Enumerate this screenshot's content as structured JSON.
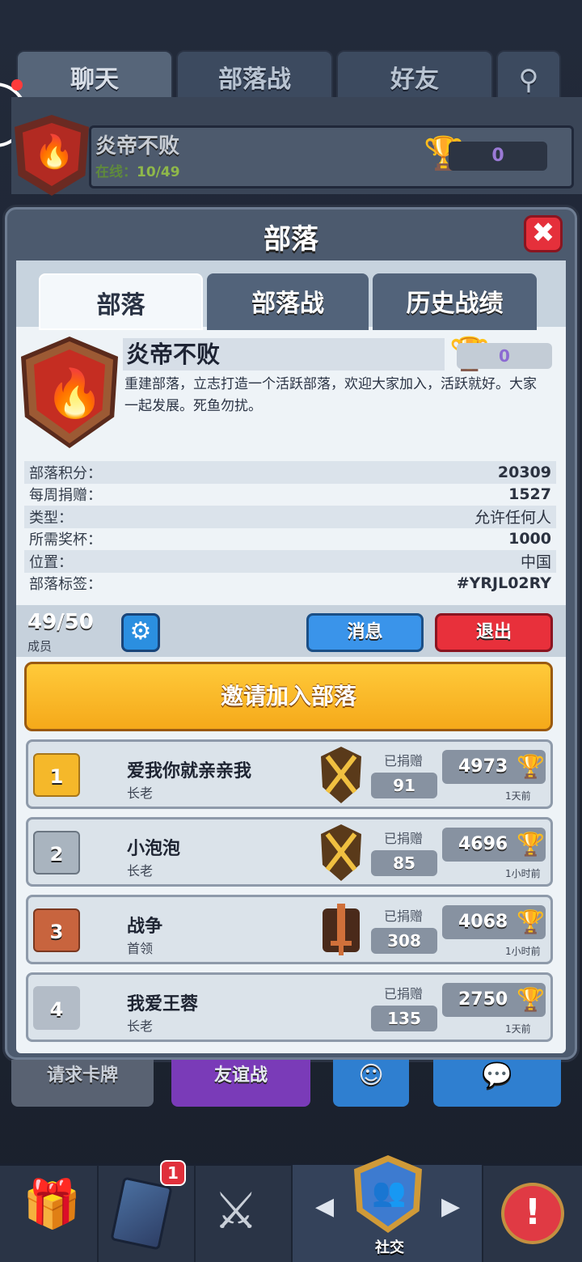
{
  "top_tabs": [
    "聊天",
    "部落战",
    "好友"
  ],
  "clan_header": {
    "name": "炎帝不败",
    "online_label": "在线：",
    "online_value": "10/49",
    "trophies": "0"
  },
  "modal": {
    "title": "部落",
    "close": "✖"
  },
  "inner_tabs": [
    "部落",
    "部落战",
    "历史战绩"
  ],
  "clan": {
    "name": "炎帝不败",
    "trophies": "0",
    "description": "重建部落，立志打造一个活跃部落，欢迎大家加入，活跃就好。大家一起发展。死鱼勿扰。"
  },
  "stats": [
    {
      "label": "部落积分：",
      "value": "20309"
    },
    {
      "label": "每周捐赠：",
      "value": "1527"
    },
    {
      "label": "类型：",
      "value": "允许任何人"
    },
    {
      "label": "所需奖杯：",
      "value": "1000"
    },
    {
      "label": "位置：",
      "value": "中国"
    },
    {
      "label": "部落标签：",
      "value": "#YRJL02RY"
    }
  ],
  "members": {
    "count": "49/50",
    "label": "成员",
    "message_button": "消息",
    "leave_button": "退出"
  },
  "invite_button": "邀请加入部落",
  "member_list": [
    {
      "rank": "1",
      "name": "爱我你就亲亲我",
      "role": "长老",
      "donated_label": "已捐赠",
      "donated": "91",
      "trophies": "4973",
      "ago": "1天前",
      "rank_color": "#f5b82a"
    },
    {
      "rank": "2",
      "name": "小泡泡",
      "role": "长老",
      "donated_label": "已捐赠",
      "donated": "85",
      "trophies": "4696",
      "ago": "1小时前",
      "rank_color": "#a9b4bf"
    },
    {
      "rank": "3",
      "name": "战争",
      "role": "首领",
      "donated_label": "已捐赠",
      "donated": "308",
      "trophies": "4068",
      "ago": "1小时前",
      "rank_color": "#c8643e"
    },
    {
      "rank": "4",
      "name": "我爱王蓉",
      "role": "长老",
      "donated_label": "已捐赠",
      "donated": "135",
      "trophies": "2750",
      "ago": "1天前",
      "rank_color": "#b3bcc7"
    }
  ],
  "bottom_buttons": [
    "请求卡牌",
    "友谊战"
  ],
  "nav": {
    "notification": "1",
    "social_label": "社交"
  }
}
